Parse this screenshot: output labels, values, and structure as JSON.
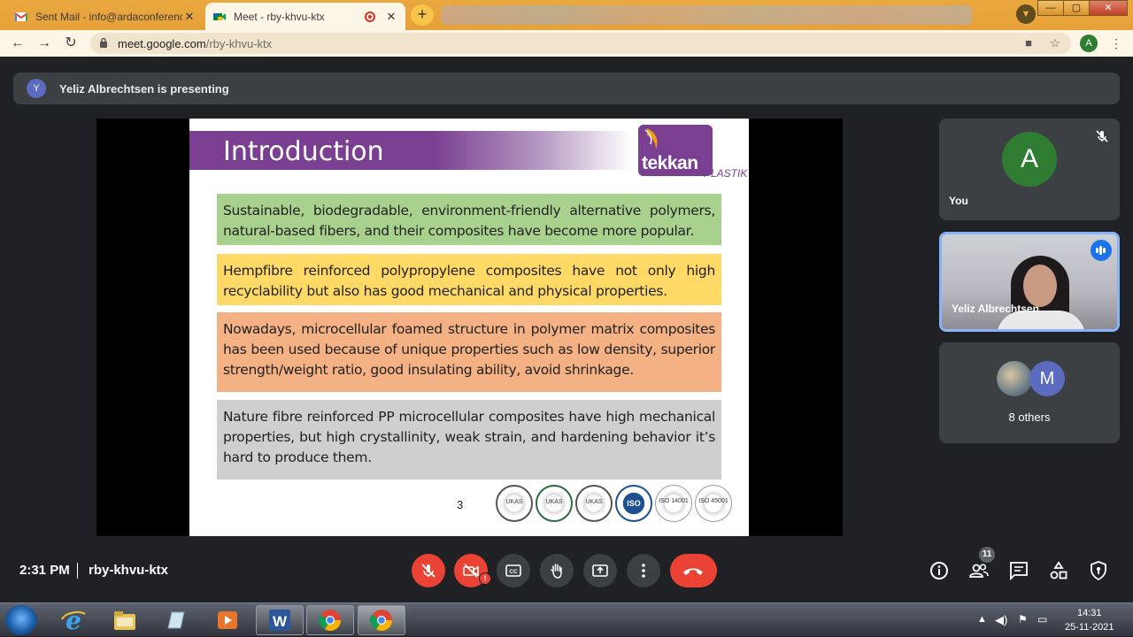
{
  "browser": {
    "tabs": [
      {
        "title": "Sent Mail - info@ardaconference",
        "active": false
      },
      {
        "title": "Meet - rby-khvu-ktx",
        "active": true
      }
    ],
    "url_host": "meet.google.com",
    "url_path": "/rby-khvu-ktx",
    "profile_initial": "A",
    "window_buttons": {
      "minimize": "—",
      "maximize": "▢",
      "close": "✕"
    }
  },
  "banner": {
    "avatar_initial": "Y",
    "text": "Yeliz Albrechtsen is presenting"
  },
  "slide": {
    "title": "Introduction",
    "logo_word": "tekkan",
    "logo_sub": "PLASTIK",
    "paragraphs": [
      {
        "text": "Sustainable, biodegradable, environment-friendly alternative polymers, natural-based fibers, and their composites have become more popular.",
        "color": "#a9d18e"
      },
      {
        "text": "Hempfibre reinforced polypropylene composites have not only high recyclability but also has good mechanical and physical properties.",
        "color": "#ffd966"
      },
      {
        "text": "Nowadays, microcellular foamed structure in polymer matrix composites has been used because of unique properties such as low density, superior strength/weight ratio, good insulating ability, avoid shrinkage.",
        "color": "#f4b183"
      },
      {
        "text": "Nature fibre reinforced PP microcellular composites have high mechanical properties, but high crystallinity, weak strain, and hardening behavior it’s hard to produce them.",
        "color": "#d0cece"
      }
    ],
    "page_number": "3",
    "certs": [
      "UKAS",
      "UKAS",
      "UKAS",
      "ISO",
      "ISO 14001",
      "ISO 45001"
    ]
  },
  "participants": {
    "self": {
      "initial": "A",
      "name": "You",
      "avatar_color": "#2e7d32"
    },
    "presenter": {
      "name": "Yeliz Albrechtsen"
    },
    "others": {
      "initial": "M",
      "label": "8 others",
      "avatar_color": "#5b6bc0"
    }
  },
  "meeting": {
    "time": "2:31 PM",
    "code": "rby-khvu-ktx",
    "people_count": "11",
    "camera_alert": "!"
  },
  "taskbar": {
    "time": "14:31",
    "date": "25-11-2021"
  },
  "colors": {
    "meet_bg": "#202124",
    "control_gray": "#3c4043",
    "danger_red": "#ea4335",
    "slide_purple": "#7a3f91",
    "tab_bar": "#e6a138"
  },
  "icons": [
    "gmail-icon",
    "meet-icon",
    "record-icon",
    "close-icon",
    "back-icon",
    "forward-icon",
    "reload-icon",
    "lock-icon",
    "camera-blocked-icon",
    "star-icon",
    "mic-off-icon",
    "camera-off-icon",
    "captions-icon",
    "raise-hand-icon",
    "present-icon",
    "more-options-icon",
    "end-call-icon",
    "info-icon",
    "people-icon",
    "chat-icon",
    "activities-icon",
    "host-controls-icon"
  ]
}
